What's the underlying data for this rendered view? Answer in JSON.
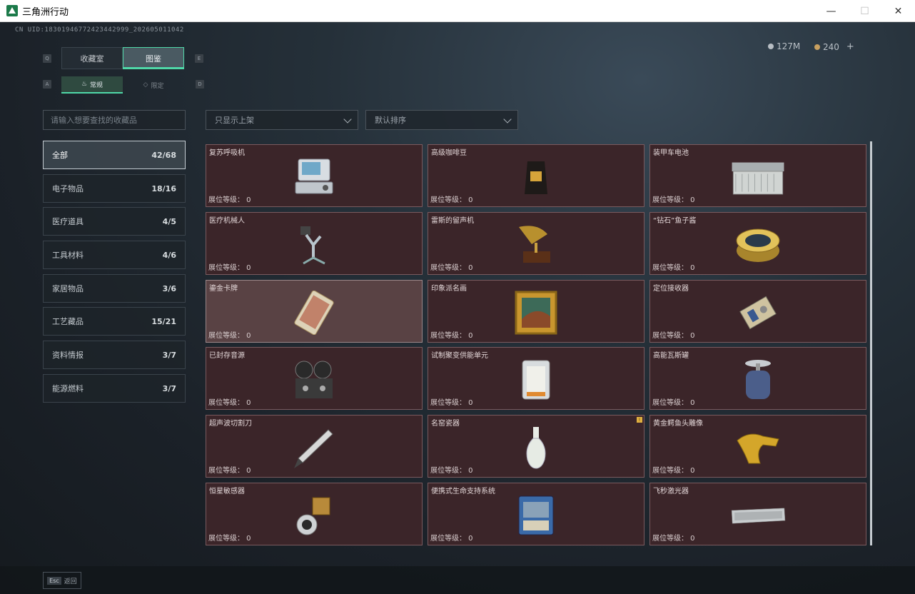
{
  "window": {
    "title": "三角洲行动",
    "minimize": "—",
    "maximize": "☐",
    "close": "✕"
  },
  "header": {
    "uid": "CN UID:18301946772423442999_202605011042",
    "currency_1": "127M",
    "currency_2": "240",
    "add": "+"
  },
  "tabs": [
    {
      "label": "收藏室",
      "key": "Q"
    },
    {
      "label": "图鉴",
      "key": "E"
    }
  ],
  "subtabs": [
    {
      "label": "常规",
      "key": "A"
    },
    {
      "label": "限定",
      "key": "D"
    }
  ],
  "search": {
    "placeholder": "请输入想要查找的收藏品"
  },
  "filters": [
    {
      "value": "只显示上架"
    },
    {
      "value": "默认排序"
    }
  ],
  "categories": [
    {
      "label": "全部",
      "count": "42/68",
      "active": true
    },
    {
      "label": "电子物品",
      "count": "18/16"
    },
    {
      "label": "医疗道具",
      "count": "4/5"
    },
    {
      "label": "工具材料",
      "count": "4/6"
    },
    {
      "label": "家居物品",
      "count": "3/6"
    },
    {
      "label": "工艺藏品",
      "count": "15/21"
    },
    {
      "label": "资料情报",
      "count": "3/7"
    },
    {
      "label": "能源燃料",
      "count": "3/7"
    }
  ],
  "level_label": "展位等级：",
  "items": [
    {
      "name": "复苏呼吸机",
      "level": "0",
      "icon": "ventilator-icon"
    },
    {
      "name": "高级咖啡豆",
      "level": "0",
      "icon": "coffee-bag-icon"
    },
    {
      "name": "装甲车电池",
      "level": "0",
      "icon": "battery-icon"
    },
    {
      "name": "医疗机械人",
      "level": "0",
      "icon": "robot-arm-icon"
    },
    {
      "name": "雷斯的留声机",
      "level": "0",
      "icon": "gramophone-icon"
    },
    {
      "name": "“钻石”鱼子酱",
      "level": "0",
      "icon": "caviar-tin-icon"
    },
    {
      "name": "鎏金卡牌",
      "level": "0",
      "icon": "card-icon"
    },
    {
      "name": "印象派名画",
      "level": "0",
      "icon": "painting-icon"
    },
    {
      "name": "定位接收器",
      "level": "0",
      "icon": "receiver-icon"
    },
    {
      "name": "已封存音源",
      "level": "0",
      "icon": "reel-recorder-icon"
    },
    {
      "name": "试制聚变供能单元",
      "level": "0",
      "icon": "fusion-cell-icon"
    },
    {
      "name": "高能瓦斯罐",
      "level": "0",
      "icon": "gas-canister-icon"
    },
    {
      "name": "超声波切割刀",
      "level": "0",
      "icon": "cutter-icon"
    },
    {
      "name": "名窑瓷器",
      "level": "0",
      "icon": "vase-icon",
      "badge": "!"
    },
    {
      "name": "黄金鳄鱼头雕像",
      "level": "0",
      "icon": "gold-croc-icon"
    },
    {
      "name": "恒星敏感器",
      "level": "0",
      "icon": "star-sensor-icon"
    },
    {
      "name": "便携式生命支持系统",
      "level": "0",
      "icon": "life-support-icon"
    },
    {
      "name": "飞秒激光器",
      "level": "0",
      "icon": "laser-case-icon"
    }
  ],
  "footer": {
    "esc_key": "Esc",
    "back": "返回"
  },
  "colors": {
    "accent": "#4fd8a8",
    "card_bg": "#3b2529",
    "card_border": "#7a5a5e"
  }
}
